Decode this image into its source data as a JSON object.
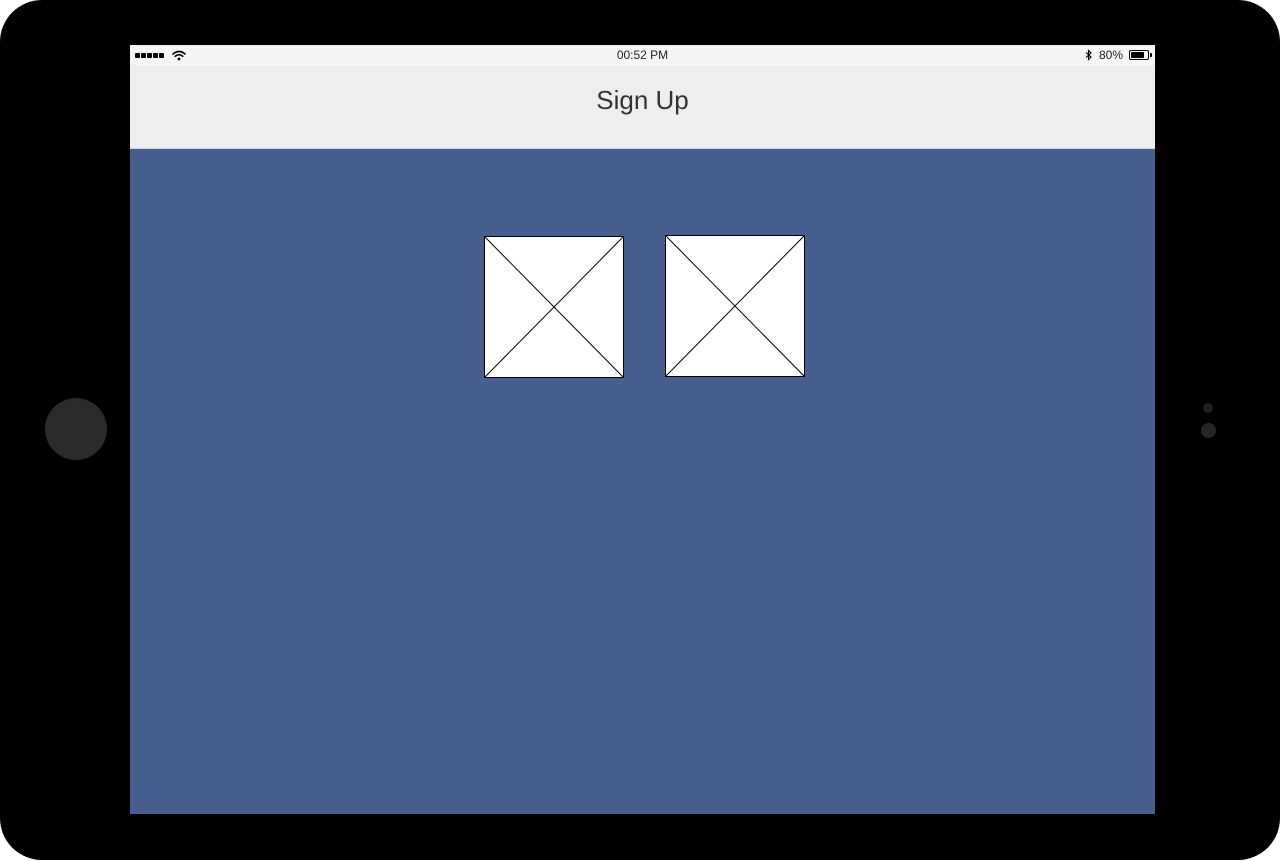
{
  "status_bar": {
    "time": "00:52 PM",
    "battery_label": "80%",
    "battery_level": 0.8,
    "signal_bars": 5,
    "icons": [
      "signal-icon",
      "wifi-icon",
      "bluetooth-icon",
      "battery-icon"
    ]
  },
  "nav_bar": {
    "title": "Sign Up"
  },
  "images": [
    {
      "icon": "image-placeholder-icon"
    },
    {
      "icon": "image-placeholder-icon"
    }
  ],
  "colors": {
    "background": "#475f8e",
    "nav_bar": "#eeeeee",
    "status_bar": "#f5f5f5",
    "device_frame": "#000000"
  }
}
